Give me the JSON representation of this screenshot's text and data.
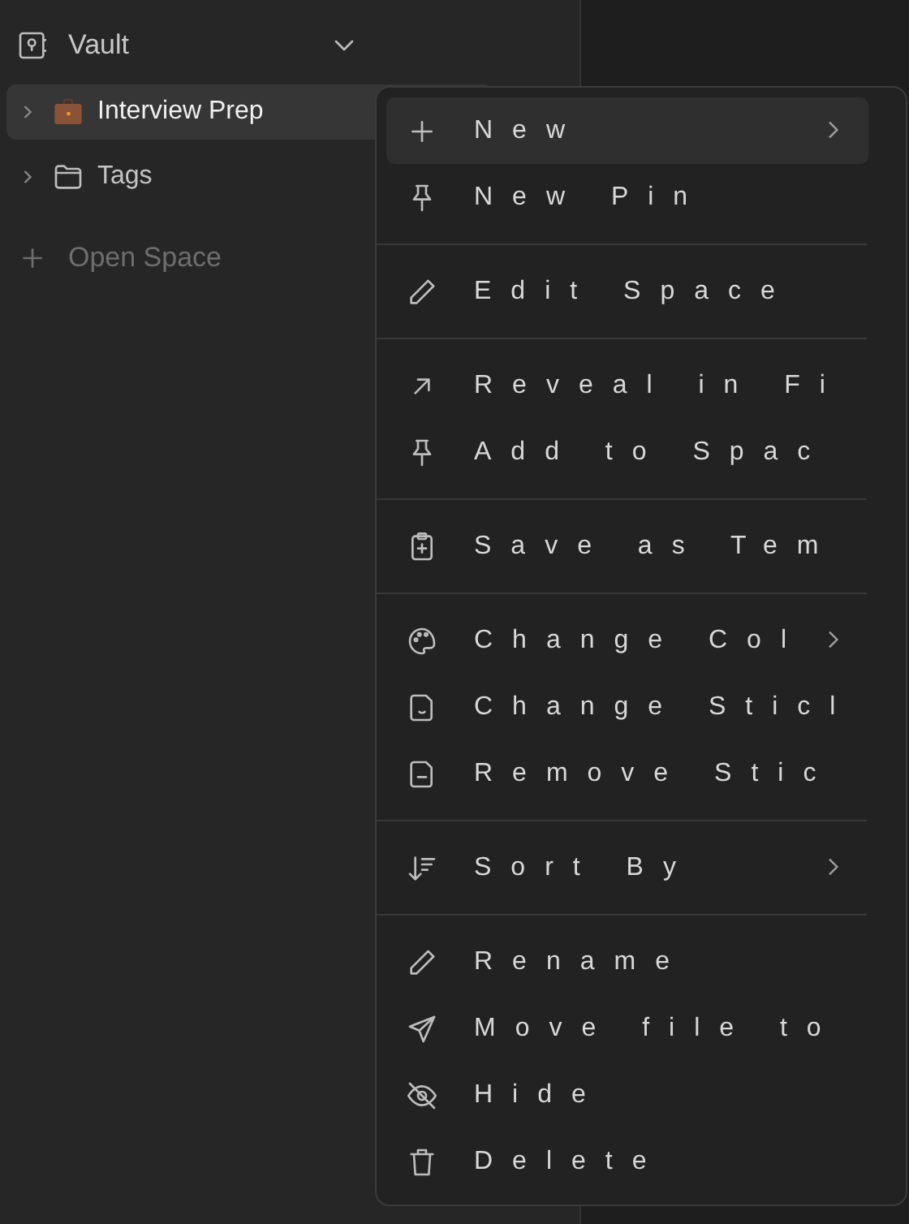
{
  "sidebar": {
    "vault": {
      "label": "Vault"
    },
    "items": [
      {
        "label": "Interview Prep",
        "selected": true,
        "expanded": false
      },
      {
        "label": "Tags",
        "selected": false,
        "expanded": false
      }
    ],
    "open_space": {
      "label": "Open Space"
    }
  },
  "context_menu": {
    "groups": [
      [
        {
          "label": "New",
          "selected": true,
          "submenu": true
        },
        {
          "label": "New Pin",
          "selected": false,
          "submenu": false
        }
      ],
      [
        {
          "label": "Edit Space",
          "selected": false,
          "submenu": false
        }
      ],
      [
        {
          "label": "Reveal in Fi",
          "selected": false,
          "submenu": false
        },
        {
          "label": "Add to Spac",
          "selected": false,
          "submenu": false
        }
      ],
      [
        {
          "label": "Save as Tem",
          "selected": false,
          "submenu": false
        }
      ],
      [
        {
          "label": "Change Col",
          "selected": false,
          "submenu": true
        },
        {
          "label": "Change Sticl",
          "selected": false,
          "submenu": false
        },
        {
          "label": "Remove Stic",
          "selected": false,
          "submenu": false
        }
      ],
      [
        {
          "label": "Sort By",
          "selected": false,
          "submenu": true
        }
      ],
      [
        {
          "label": "Rename",
          "selected": false,
          "submenu": false
        },
        {
          "label": "Move file to",
          "selected": false,
          "submenu": false
        },
        {
          "label": "Hide",
          "selected": false,
          "submenu": false
        },
        {
          "label": "Delete",
          "selected": false,
          "submenu": false
        }
      ]
    ]
  }
}
